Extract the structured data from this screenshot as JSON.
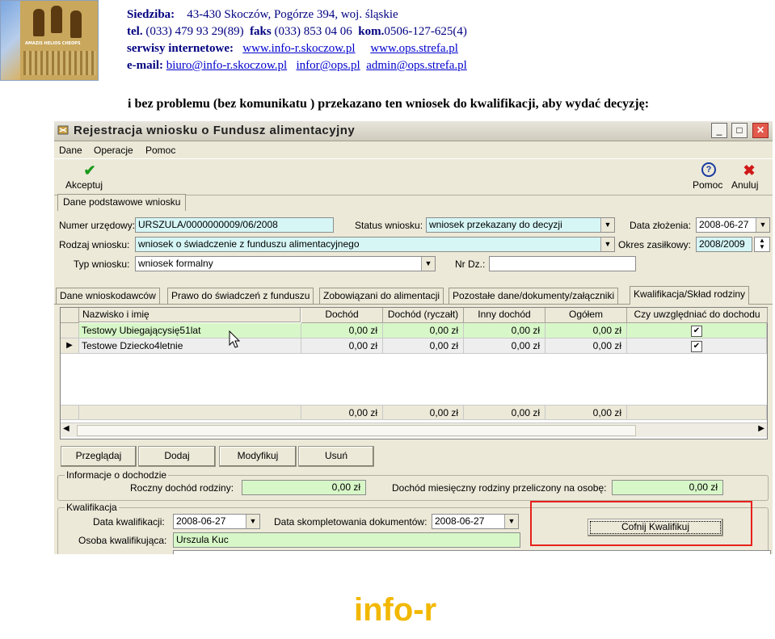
{
  "header": {
    "seat_label": "Siedziba:",
    "seat_value": "43-430 Skoczów,  Pogórze 394,  woj. śląskie",
    "tel_label": "tel.",
    "tel_value": "(033) 479 93 29(89)",
    "fax_label": "faks",
    "fax_value": "(033) 853 04 06",
    "kom_label": "kom.",
    "kom_value": "0506-127-625(4)",
    "web_label": "serwisy internetowe:",
    "web_link1": "www.info-r.skoczow.pl",
    "web_link2": "www.ops.strefa.pl",
    "email_label": "e-mail:",
    "email_link1": "biuro@info-r.skoczow.pl",
    "email_link2": "infor@ops.pl",
    "email_link3": "admin@ops.strefa.pl",
    "logo_caption": "AMAZIS HELIOS CHEOPS"
  },
  "intro_text": "i bez problemu (bez komunikatu ) przekazano ten wniosek do kwalifikacji, aby wydać decyzję:",
  "window": {
    "title": "Rejestracja wniosku o Fundusz alimentacyjny",
    "controls": {
      "minimize": "_",
      "maximize": "□",
      "close": "✕"
    },
    "menu": [
      "Dane",
      "Operacje",
      "Pomoc"
    ],
    "toolbar": {
      "accept_label": "Akceptuj",
      "help_label": "Pomoc",
      "cancel_label": "Anuluj",
      "accept_icon": "check-icon",
      "help_icon": "help-icon",
      "cancel_icon": "cross-icon"
    },
    "top_tab": "Dane podstawowe wniosku",
    "form": {
      "numer_label": "Numer urzędowy:",
      "numer_value": "URSZULA/0000000009/06/2008",
      "status_label": "Status wniosku:",
      "status_value": "wniosek przekazany do decyzji",
      "data_zlozenia_label": "Data złożenia:",
      "data_zlozenia_value": "2008-06-27",
      "rodzaj_label": "Rodzaj wniosku:",
      "rodzaj_value": "wniosek o świadczenie z funduszu alimentacyjnego",
      "okres_label": "Okres zasiłkowy:",
      "okres_value": "2008/2009",
      "typ_label": "Typ wniosku:",
      "typ_value": "wniosek formalny",
      "nrdz_label": "Nr Dz.:",
      "nrdz_value": ""
    },
    "tabs": [
      "Dane wnioskodawców",
      "Prawo do świadczeń z funduszu",
      "Zobowiązani do alimentacji",
      "Pozostałe dane/dokumenty/załączniki",
      "Kwalifikacja/Skład rodziny"
    ],
    "active_tab": "Kwalifikacja/Skład rodziny",
    "grid": {
      "columns": [
        "Nazwisko i imię",
        "Dochód",
        "Dochód (ryczałt)",
        "Inny dochód",
        "Ogółem",
        "Czy uwzględniać do dochodu"
      ],
      "rows": [
        {
          "name": "Testowy Ubiegającysię51lat",
          "dochod": "0,00 zł",
          "ryczalt": "0,00 zł",
          "inny": "0,00 zł",
          "ogolem": "0,00 zł",
          "checked": "✔"
        },
        {
          "name": "Testowe Dziecko4letnie",
          "dochod": "0,00 zł",
          "ryczalt": "0,00 zł",
          "inny": "0,00 zł",
          "ogolem": "0,00 zł",
          "checked": "✔"
        }
      ],
      "totals": {
        "dochod": "0,00 zł",
        "ryczalt": "0,00 zł",
        "inny": "0,00 zł",
        "ogolem": "0,00 zł"
      },
      "row_pointer": "▶"
    },
    "buttons": [
      "Przeglądaj",
      "Dodaj",
      "Modyfikuj",
      "Usuń"
    ],
    "income": {
      "group_label": "Informacje o dochodzie",
      "annual_label": "Roczny dochód rodziny:",
      "annual_value": "0,00 zł",
      "monthly_label": "Dochód miesięczny rodziny przeliczony na osobę:",
      "monthly_value": "0,00 zł"
    },
    "qualification": {
      "group_label": "Kwalifikacja",
      "date_label": "Data kwalifikacji:",
      "date_value": "2008-06-27",
      "docs_label": "Data skompletowania dokumentów:",
      "docs_value": "2008-06-27",
      "person_label": "Osoba kwalifikująca:",
      "person_value": "Urszula Kuc",
      "undo_button": "Cofnij Kwalifikuj"
    },
    "highlight_color": "#e8201c"
  },
  "footer_logo_text": "info-r"
}
